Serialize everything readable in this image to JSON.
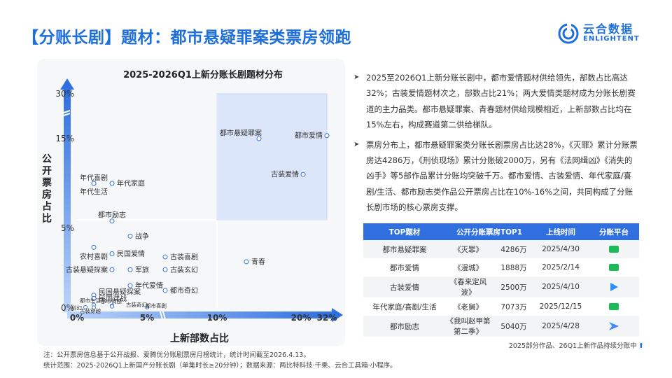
{
  "title": "【分账长剧】题材：都市悬疑罪案类票房领跑",
  "logo": {
    "cn": "云合数据",
    "en": "ENLIGHTENT"
  },
  "chart_data": {
    "type": "scatter",
    "title": "2025-2026Q1上新分账长剧题材分布",
    "xlabel": "上新部数占比",
    "ylabel": "公开票房占比",
    "x_ticks": [
      "0%",
      "5%",
      "10%",
      "20%",
      "32%"
    ],
    "y_ticks": [
      "0%",
      "5%",
      "15%",
      "30%"
    ],
    "points": [
      {
        "label": "都市悬疑罪案",
        "x": 15,
        "y": 15
      },
      {
        "label": "都市爱情",
        "x": 32,
        "y": 16
      },
      {
        "label": "古装爱情",
        "x": 21,
        "y": 11
      },
      {
        "label": "年代家庭",
        "x": 2.5,
        "y": 10
      },
      {
        "label": "年代生活",
        "x": 1.2,
        "y": 10
      },
      {
        "label": "年代喜剧",
        "x": 1.2,
        "y": 10
      },
      {
        "label": "都市励志",
        "x": 2.5,
        "y": 5.8
      },
      {
        "label": "战争",
        "x": 3.8,
        "y": 4.5
      },
      {
        "label": "农村喜剧",
        "x": 1.2,
        "y": 3.8
      },
      {
        "label": "民国爱情",
        "x": 2.5,
        "y": 3.4
      },
      {
        "label": "古装悬疑探案",
        "x": 2.5,
        "y": 2.4
      },
      {
        "label": "军旅",
        "x": 3.8,
        "y": 2.4
      },
      {
        "label": "古装喜剧",
        "x": 6.3,
        "y": 3.2
      },
      {
        "label": "古装玄幻",
        "x": 6.3,
        "y": 2.4
      },
      {
        "label": "青春",
        "x": 13.5,
        "y": 2.9
      },
      {
        "label": "年代爱情",
        "x": 3.8,
        "y": 1.4
      },
      {
        "label": "都市奇幻",
        "x": 6.3,
        "y": 1.1
      },
      {
        "label": "民国悬疑探案",
        "x": 1.2,
        "y": 0.8
      },
      {
        "label": "民国谍战",
        "x": 1.2,
        "y": 0.6
      },
      {
        "label": "都市生活",
        "x": 1.2,
        "y": 0.2
      },
      {
        "label": "都市情感",
        "x": 2.5,
        "y": 0.15
      },
      {
        "label": "古装奇幻",
        "x": 2.5,
        "y": 0.1
      },
      {
        "label": "都市喜剧",
        "x": 5,
        "y": 0.05
      },
      {
        "label": "科幻",
        "x": 0.6,
        "y": 0.05
      },
      {
        "label": "古装穿越",
        "x": 1.2,
        "y": 0.03
      }
    ]
  },
  "bullets": [
    "2025至2026Q1上新分账长剧中，都市爱情题材供给领先，部数占比高达32%；古装爱情题材次之，部数占比21%；两大爱情类题材成为分账长剧赛道的主力品类。都市悬疑罪案、青春题材供给规模相近，上新部数占比均在15%左右，构成赛道第二供给梯队。",
    "票房分布上，都市悬疑罪案类分账长剧票房占比达28%，《灭罪》累计分账票房达4286万，《刑侦现场》累计分账破2000万，另有《法网缉凶》《消失的凶手》等5部作品累计分账均突破千万。都市爱情、古装爱情、年代家庭/喜剧/生活、都市励志类作品公开票房占比在10%-16%之间，共同构成了分账长剧市场的核心票房支撑。"
  ],
  "table": {
    "headers": [
      "TOP题材",
      "公开分账票房TOP1",
      "上线时间",
      "分账平台"
    ],
    "rows": [
      {
        "genre": "都市悬疑罪案",
        "title": "《灭罪》",
        "amount": "4286万",
        "date": "2025/4/30",
        "platform": "iqiyi-icon"
      },
      {
        "genre": "都市爱情",
        "title": "《漫城》",
        "amount": "1888万",
        "date": "2025/2/14",
        "platform": "iqiyi-icon"
      },
      {
        "genre": "古装爱情",
        "title": "《春来定风波》",
        "amount": "2500万",
        "date": "2025/4/10",
        "platform": "tencent-video-icon"
      },
      {
        "genre": "年代家庭/喜剧/生活",
        "title": "《老舅》",
        "amount": "7073万",
        "date": "2025/12/15",
        "platform": "iqiyi-icon"
      },
      {
        "genre": "都市励志",
        "title": "《我叫赵甲第第二季》",
        "amount": "5040万",
        "date": "2025/4/28",
        "platform": "youku-icon"
      }
    ]
  },
  "table_note": "2025部分作品、26Q1上新作品持续分账中",
  "footnote": [
    "注：公开票房信息基于公开战报、爱腾优分账剧票房月榜统计，统计时间截至2026.4.13。",
    "统计范围：2025-2026Q1上新国产分账长剧（单集时长≥20分钟）；数据来源：两比特科技·千乘、云合工具箱·小程序。"
  ],
  "colors": {
    "accent": "#1e6fd9",
    "table_header": "#2f6fe0",
    "quadrant": "#dbe6fb",
    "iqiyi": "#1dbb58",
    "tencent": "#2b8fff"
  }
}
